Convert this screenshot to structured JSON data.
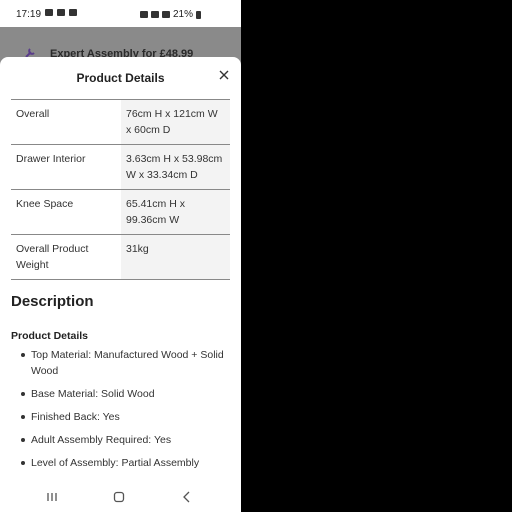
{
  "status_bar": {
    "time": "17:19",
    "battery": "21%"
  },
  "background": {
    "assembly_text": "Expert Assembly for £48.99"
  },
  "modal": {
    "title": "Product Details",
    "table": [
      {
        "label": "Overall",
        "value": "76cm H x 121cm W x 60cm D"
      },
      {
        "label": "Drawer Interior",
        "value": "3.63cm H x 53.98cm W x 33.34cm D"
      },
      {
        "label": "Knee Space",
        "value": "65.41cm H x 99.36cm W"
      },
      {
        "label": "Overall Product Weight",
        "value": "31kg"
      }
    ],
    "description_heading": "Description",
    "product_details_heading": "Product Details",
    "bullets": [
      "Top Material: Manufactured Wood + Solid Wood",
      "Base Material: Solid Wood",
      "Finished Back: Yes",
      "Adult Assembly Required: Yes",
      "Level of Assembly: Partial Assembly"
    ]
  },
  "icons": {
    "close": "close-icon",
    "wrench": "wrench-icon",
    "recents": "recents-icon",
    "home": "home-icon",
    "back": "back-icon"
  }
}
